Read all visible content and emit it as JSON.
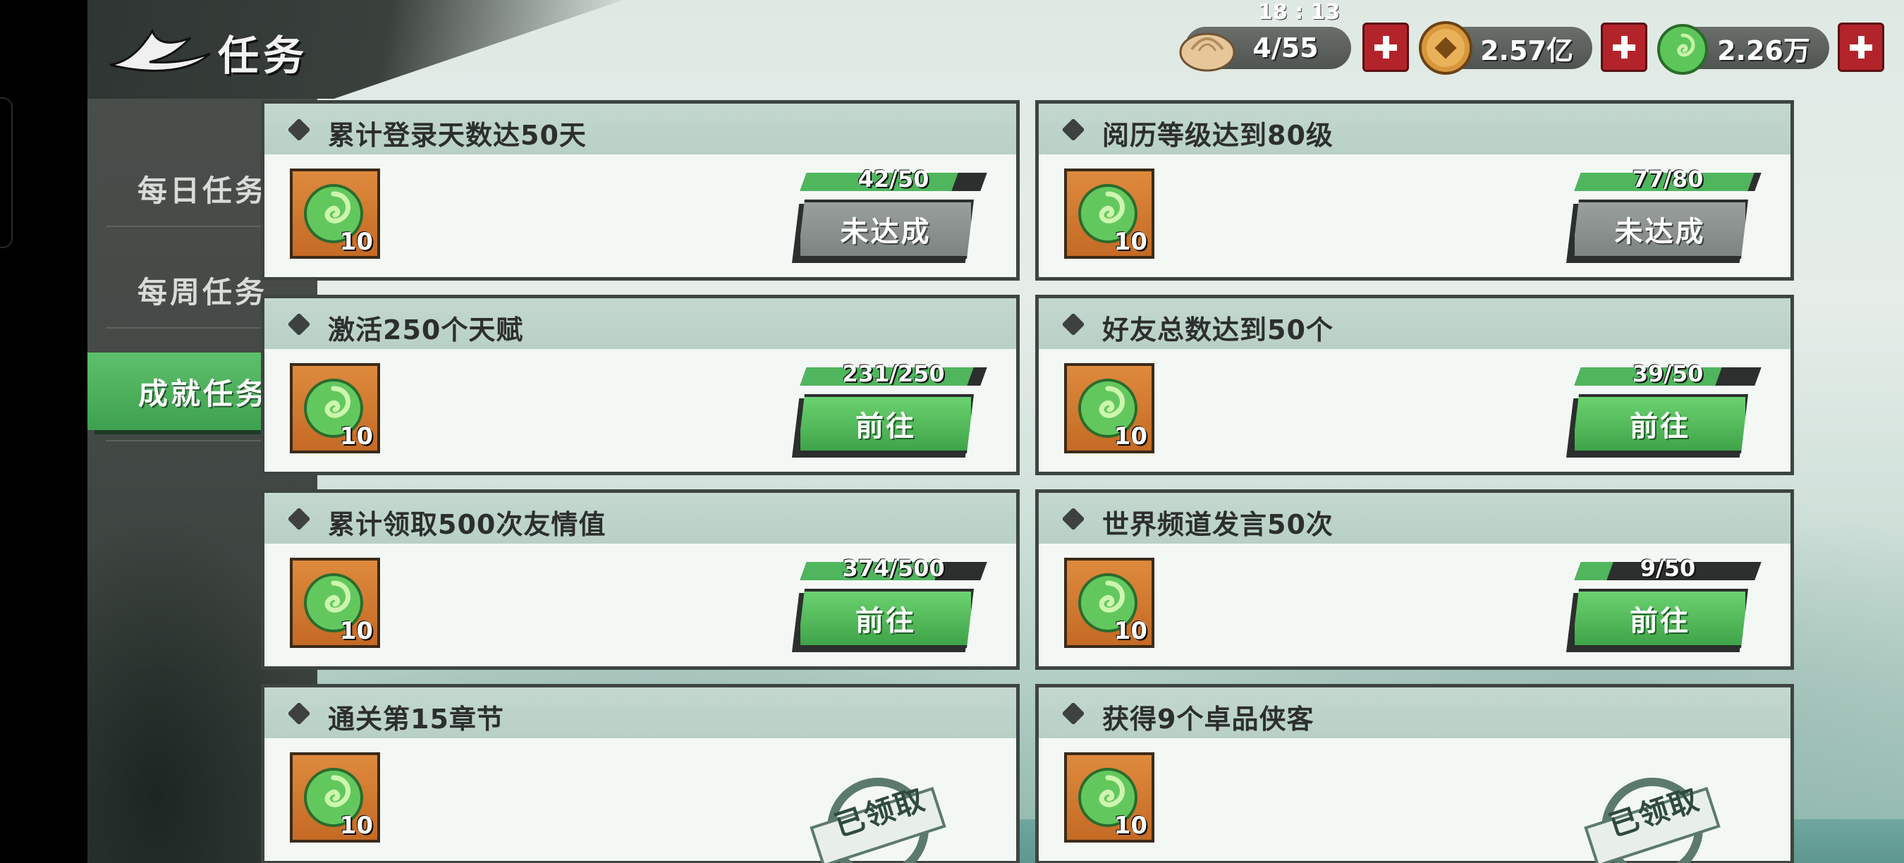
{
  "status_time": "18 : 13",
  "header": {
    "title": "任务"
  },
  "currencies": [
    {
      "icon": "steamed-bun-icon",
      "value": "4/55"
    },
    {
      "icon": "copper-coin-icon",
      "value": "2.57亿"
    },
    {
      "icon": "jade-icon",
      "value": "2.26万"
    }
  ],
  "sidebar": {
    "tabs": [
      {
        "label": "每日任务",
        "active": false
      },
      {
        "label": "每周任务",
        "active": false
      },
      {
        "label": "成就任务",
        "active": true
      }
    ]
  },
  "tasks": [
    {
      "title": "累计登录天数达50天",
      "reward_count": "10",
      "progress": "42/50",
      "progress_ratio": 0.84,
      "button": "未达成",
      "state": "incomplete"
    },
    {
      "title": "阅历等级达到80级",
      "reward_count": "10",
      "progress": "77/80",
      "progress_ratio": 0.9625,
      "button": "未达成",
      "state": "incomplete"
    },
    {
      "title": "激活250个天赋",
      "reward_count": "10",
      "progress": "231/250",
      "progress_ratio": 0.924,
      "button": "前往",
      "state": "go"
    },
    {
      "title": "好友总数达到50个",
      "reward_count": "10",
      "progress": "39/50",
      "progress_ratio": 0.78,
      "button": "前往",
      "state": "go"
    },
    {
      "title": "累计领取500次友情值",
      "reward_count": "10",
      "progress": "374/500",
      "progress_ratio": 0.748,
      "button": "前往",
      "state": "go"
    },
    {
      "title": "世界频道发言50次",
      "reward_count": "10",
      "progress": "9/50",
      "progress_ratio": 0.18,
      "button": "前往",
      "state": "go"
    },
    {
      "title": "通关第15章节",
      "reward_count": "10",
      "stamp": "已领取",
      "state": "claimed"
    },
    {
      "title": "获得9个卓品侠客",
      "reward_count": "10",
      "stamp": "已领取",
      "state": "claimed"
    }
  ],
  "colors": {
    "accent_green": "#4fb65d",
    "plus_red": "#b3242a",
    "sidebar_bg": "#454a47"
  }
}
